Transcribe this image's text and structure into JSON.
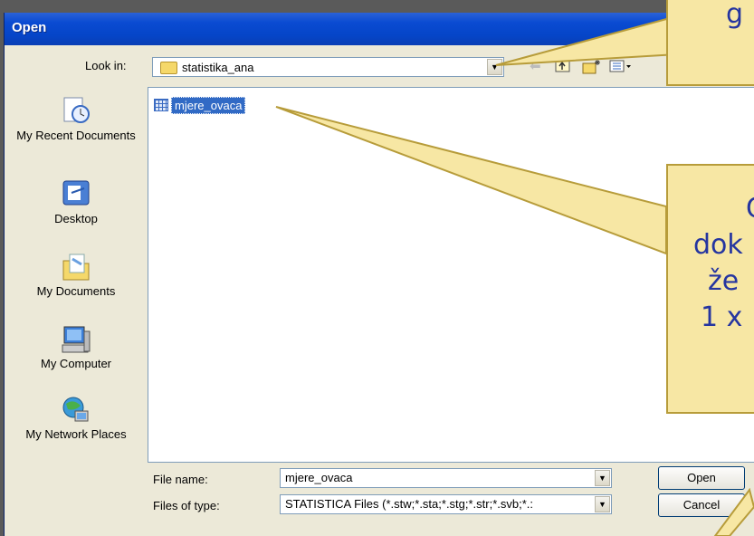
{
  "window": {
    "title": "Open"
  },
  "look_in": {
    "label": "Look in:",
    "value": "statistika_ana"
  },
  "places": [
    {
      "label": "My Recent Documents",
      "icon": "recent-documents-icon"
    },
    {
      "label": "Desktop",
      "icon": "desktop-icon"
    },
    {
      "label": "My Documents",
      "icon": "my-documents-icon"
    },
    {
      "label": "My Computer",
      "icon": "my-computer-icon"
    },
    {
      "label": "My Network Places",
      "icon": "network-places-icon"
    }
  ],
  "files": [
    {
      "name": "mjere_ovaca",
      "selected": true
    }
  ],
  "file_name": {
    "label": "File name:",
    "value": "mjere_ovaca"
  },
  "file_type": {
    "label": "Files of type:",
    "value": "STATISTICA Files (*.stw;*.sta;*.stg;*.str;*.svb;*.:"
  },
  "buttons": {
    "open": "Open",
    "cancel": "Cancel"
  },
  "callouts": {
    "top_text": "g",
    "middle_lines": [
      "C",
      "dok",
      "že",
      "1 x"
    ]
  },
  "colors": {
    "titlebar": "#0a4bd2",
    "callout_bg": "#f7e7a4",
    "callout_text": "#2535a0",
    "selection": "#316ac5"
  }
}
